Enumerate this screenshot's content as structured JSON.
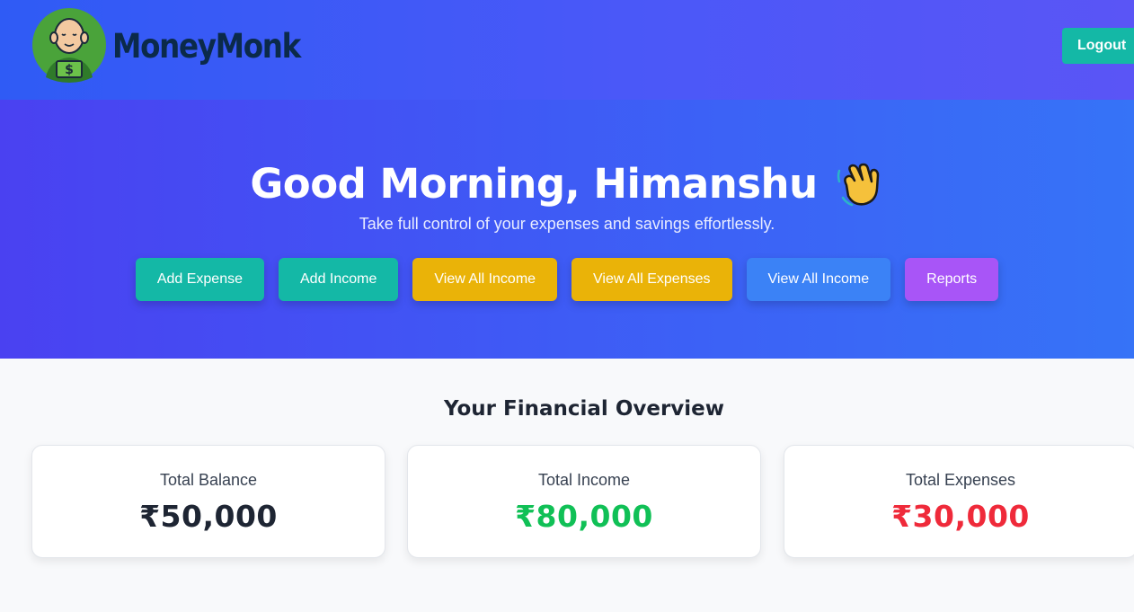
{
  "app": {
    "name": "MoneyMonk"
  },
  "header": {
    "logout_label": "Logout"
  },
  "hero": {
    "greeting": "Good Morning, Himanshu",
    "wave_emoji": "👋",
    "subtitle": "Take full control of your expenses and savings effortlessly.",
    "actions": [
      {
        "label": "Add Expense",
        "color": "#14b8a6"
      },
      {
        "label": "Add Income",
        "color": "#14b8a6"
      },
      {
        "label": "View All Income",
        "color": "#eab308"
      },
      {
        "label": "View All Expenses",
        "color": "#eab308"
      },
      {
        "label": "View All Income",
        "color": "#3b82f6"
      },
      {
        "label": "Reports",
        "color": "#a855f7"
      }
    ]
  },
  "overview": {
    "title": "Your Financial Overview",
    "cards": [
      {
        "label": "Total Balance",
        "value": "₹50,000",
        "color": "#1e2533"
      },
      {
        "label": "Total Income",
        "value": "₹80,000",
        "color": "#10c056"
      },
      {
        "label": "Total Expenses",
        "value": "₹30,000",
        "color": "#ef2a3a"
      }
    ]
  },
  "colors": {
    "accent": "#14b8a6",
    "income": "#10c056",
    "expense": "#ef2a3a"
  }
}
